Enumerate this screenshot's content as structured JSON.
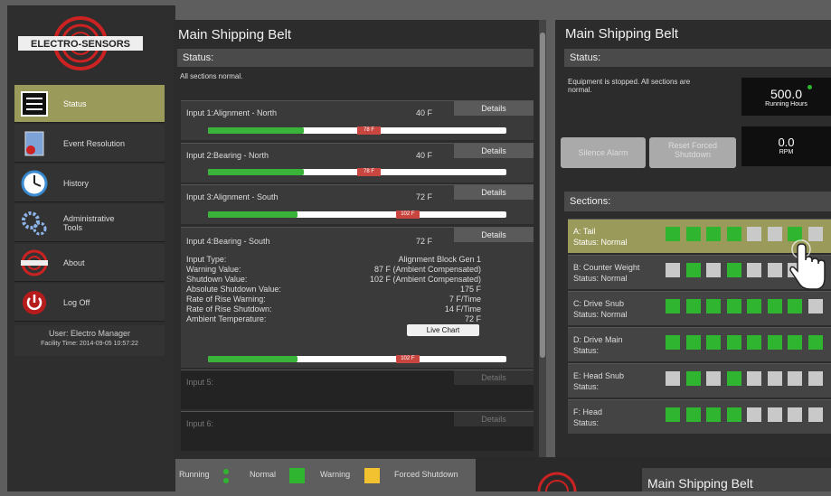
{
  "brand": {
    "logo_text": "ELECTRO-SENSORS"
  },
  "sidebar": {
    "items": [
      {
        "label": "Status",
        "icon": "monitor-icon"
      },
      {
        "label": "Event Resolution",
        "icon": "event-document-icon"
      },
      {
        "label": "History",
        "icon": "clock-icon"
      },
      {
        "label": "Administrative Tools",
        "icon": "gears-icon"
      },
      {
        "label": "About",
        "icon": "logo-icon"
      },
      {
        "label": "Log Off",
        "icon": "power-icon"
      }
    ],
    "user": "User:  Electro Manager",
    "facility_time": "Facility Time: 2014-09-05 10:57:22"
  },
  "main": {
    "title": "Main Shipping Belt",
    "status_header": "Status:",
    "status_text": "All sections normal.",
    "details_label": "Details",
    "inputs": [
      {
        "label": "Input 1:Alignment - North",
        "value": "40 F",
        "marker": "78 F",
        "fill": 0.5
      },
      {
        "label": "Input 2:Bearing - North",
        "value": "40 F",
        "marker": "78 F",
        "fill": 0.5
      },
      {
        "label": "Input 3:Alignment - South",
        "value": "72 F",
        "marker": "102 F",
        "fill": 0.3
      },
      {
        "label": "Input 4:Bearing - South",
        "value": "72 F",
        "marker": "102 F",
        "fill": 0.3
      },
      {
        "label": "Input 5:"
      },
      {
        "label": "Input 6:"
      }
    ],
    "input4_details": [
      {
        "k": "Input Type:",
        "v": "Alignment Block Gen 1"
      },
      {
        "k": "Warning Value:",
        "v": "87 F (Ambient Compensated)"
      },
      {
        "k": "Shutdown Value:",
        "v": "102 F (Ambient Compensated)"
      },
      {
        "k": "Absolute Shutdown Value:",
        "v": "175 F"
      },
      {
        "k": "Rate of Rise Warning:",
        "v": "7 F/Time"
      },
      {
        "k": "Rate of Rise Shutdown:",
        "v": "14 F/Time"
      },
      {
        "k": "Ambient Temperature:",
        "v": "72 F"
      }
    ],
    "live_chart_label": "Live Chart"
  },
  "legend": {
    "running": "Running",
    "normal": "Normal",
    "warning": "Warning",
    "forced": "Forced Shutdown"
  },
  "right": {
    "title": "Main Shipping Belt",
    "status_header": "Status:",
    "status_text": "Equipment is stopped. All sections are normal.",
    "running_hours_value": "500.0",
    "running_hours_label": "Running Hours",
    "rpm_value": "0.0",
    "rpm_label": "RPM",
    "silence_alarm": "Silence Alarm",
    "reset_forced": "Reset Forced Shutdown",
    "sections_header": "Sections:",
    "sections": [
      {
        "name": "A: Tail",
        "status": "Status:  Normal",
        "cells": [
          "g",
          "g",
          "g",
          "g",
          "x",
          "x",
          "g",
          "x"
        ]
      },
      {
        "name": "B: Counter Weight",
        "status": "Status:  Normal",
        "cells": [
          "x",
          "g",
          "x",
          "g",
          "x",
          "x",
          "x",
          "x"
        ]
      },
      {
        "name": "C: Drive Snub",
        "status": "Status:  Normal",
        "cells": [
          "g",
          "g",
          "g",
          "g",
          "g",
          "g",
          "g",
          "x"
        ]
      },
      {
        "name": "D: Drive Main",
        "status": "Status:",
        "cells": [
          "g",
          "g",
          "g",
          "g",
          "g",
          "g",
          "g",
          "g"
        ]
      },
      {
        "name": "E: Head Snub",
        "status": "Status:",
        "cells": [
          "x",
          "g",
          "x",
          "g",
          "x",
          "x",
          "x",
          "x"
        ]
      },
      {
        "name": "F: Head",
        "status": "Status:",
        "cells": [
          "g",
          "g",
          "g",
          "g",
          "x",
          "x",
          "x",
          "x"
        ]
      }
    ]
  },
  "bottom_window": {
    "title": "Main Shipping Belt"
  },
  "colors": {
    "normal": "#2fb52f",
    "warning": "#f2c230",
    "alarm": "#c9453f",
    "active": "#9a9a5a"
  }
}
